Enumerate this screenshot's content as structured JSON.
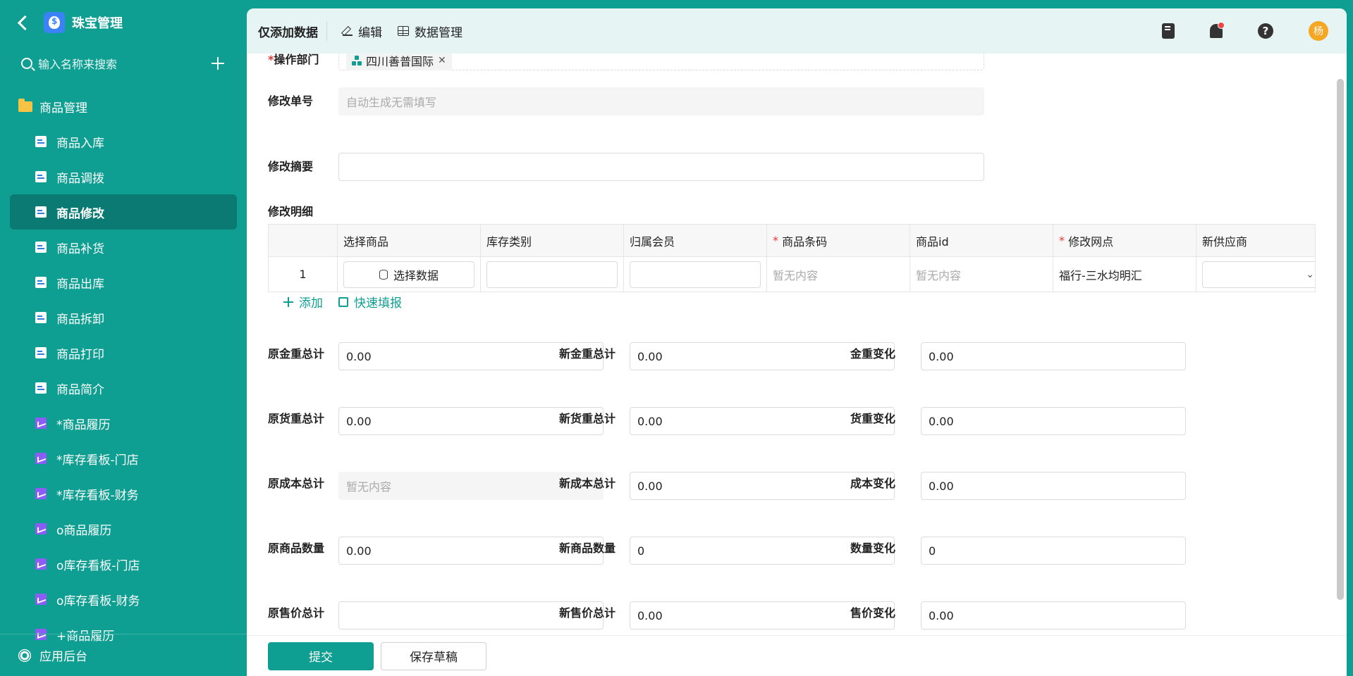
{
  "sidebar": {
    "app_title": "珠宝管理",
    "search_placeholder": "输入名称来搜索",
    "group_label": "商品管理",
    "items": [
      {
        "label": "商品入库",
        "icon": "doc-icon"
      },
      {
        "label": "商品调拨",
        "icon": "doc-icon"
      },
      {
        "label": "商品修改",
        "icon": "doc-icon",
        "active": true
      },
      {
        "label": "商品补货",
        "icon": "doc-icon"
      },
      {
        "label": "商品出库",
        "icon": "doc-icon"
      },
      {
        "label": "商品拆卸",
        "icon": "doc-icon"
      },
      {
        "label": "商品打印",
        "icon": "doc-icon"
      },
      {
        "label": "商品简介",
        "icon": "doc-icon"
      },
      {
        "label": "*商品履历",
        "icon": "chart-icon"
      },
      {
        "label": "*库存看板-门店",
        "icon": "chart-icon"
      },
      {
        "label": "*库存看板-财务",
        "icon": "chart-icon"
      },
      {
        "label": "o商品履历",
        "icon": "chart-icon"
      },
      {
        "label": "o库存看板-门店",
        "icon": "chart-icon"
      },
      {
        "label": "o库存看板-财务",
        "icon": "chart-icon"
      },
      {
        "label": "+商品履历",
        "icon": "chart-icon"
      }
    ],
    "footer_label": "应用后台"
  },
  "topbar": {
    "title": "仅添加数据",
    "edit_label": "编辑",
    "data_mgmt_label": "数据管理",
    "avatar_text": "杨"
  },
  "form": {
    "dept_label": "操作部门",
    "dept_tag": "四川善普国际",
    "order_no_label": "修改单号",
    "order_no_placeholder": "自动生成无需填写",
    "summary_label": "修改摘要",
    "summary_value": "",
    "detail_label": "修改明细"
  },
  "table": {
    "headers": [
      "",
      "选择商品",
      "库存类别",
      "归属会员",
      "商品条码",
      "商品id",
      "修改网点",
      "新供应商"
    ],
    "row": {
      "index": "1",
      "select_btn": "选择数据",
      "barcode": "暂无内容",
      "product_id": "暂无内容",
      "branch": "福行-三水均明汇"
    },
    "add_label": "添加",
    "quick_fill_label": "快速填报"
  },
  "totals": [
    [
      {
        "label": "原金重总计",
        "value": "0.00"
      },
      {
        "label": "新金重总计",
        "value": "0.00"
      },
      {
        "label": "金重变化",
        "value": "0.00"
      }
    ],
    [
      {
        "label": "原货重总计",
        "value": "0.00"
      },
      {
        "label": "新货重总计",
        "value": "0.00"
      },
      {
        "label": "货重变化",
        "value": "0.00"
      }
    ],
    [
      {
        "label": "原成本总计",
        "value": "暂无内容",
        "disabled": true
      },
      {
        "label": "新成本总计",
        "value": "0.00"
      },
      {
        "label": "成本变化",
        "value": "0.00"
      }
    ],
    [
      {
        "label": "原商品数量",
        "value": "0.00"
      },
      {
        "label": "新商品数量",
        "value": "0"
      },
      {
        "label": "数量变化",
        "value": "0"
      }
    ],
    [
      {
        "label": "原售价总计",
        "value": ""
      },
      {
        "label": "新售价总计",
        "value": "0.00"
      },
      {
        "label": "售价变化",
        "value": "0.00"
      }
    ]
  ],
  "footer": {
    "submit_label": "提交",
    "draft_label": "保存草稿"
  },
  "colors": {
    "brand": "#0f9e92",
    "required": "#e53935",
    "avatar": "#f5a623"
  }
}
